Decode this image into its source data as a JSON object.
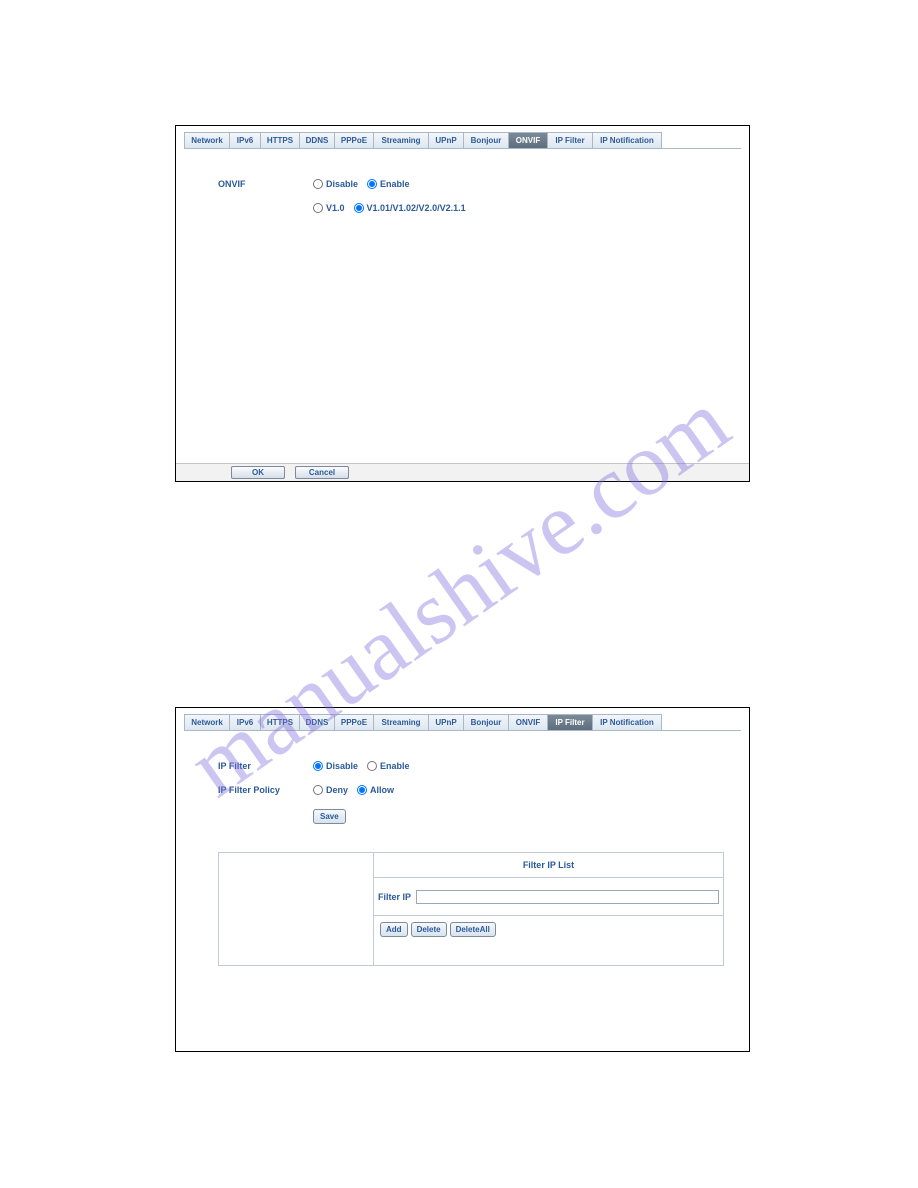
{
  "watermark": "manualshive.com",
  "tabs": [
    "Network",
    "IPv6",
    "HTTPS",
    "DDNS",
    "PPPoE",
    "Streaming",
    "UPnP",
    "Bonjour",
    "ONVIF",
    "IP Filter",
    "IP Notification"
  ],
  "tab_widths": [
    46,
    32,
    40,
    36,
    40,
    56,
    36,
    46,
    40,
    46,
    70
  ],
  "panel1": {
    "active_tab": 8,
    "title": "ONVIF",
    "row1": {
      "o1": "Disable",
      "o2": "Enable",
      "sel": 1
    },
    "row2": {
      "o1": "V1.0",
      "o2": "V1.01/V1.02/V2.0/V2.1.1",
      "sel": 1
    },
    "ok": "OK",
    "cancel": "Cancel"
  },
  "panel2": {
    "active_tab": 9,
    "t1": "IP Filter",
    "t2": "IP Filter Policy",
    "row1": {
      "o1": "Disable",
      "o2": "Enable",
      "sel": 0
    },
    "row2": {
      "o1": "Deny",
      "o2": "Allow",
      "sel": 1
    },
    "save": "Save",
    "listhead": "Filter IP List",
    "filterip": "Filter IP",
    "add": "Add",
    "del": "Delete",
    "delall": "DeleteAll"
  }
}
